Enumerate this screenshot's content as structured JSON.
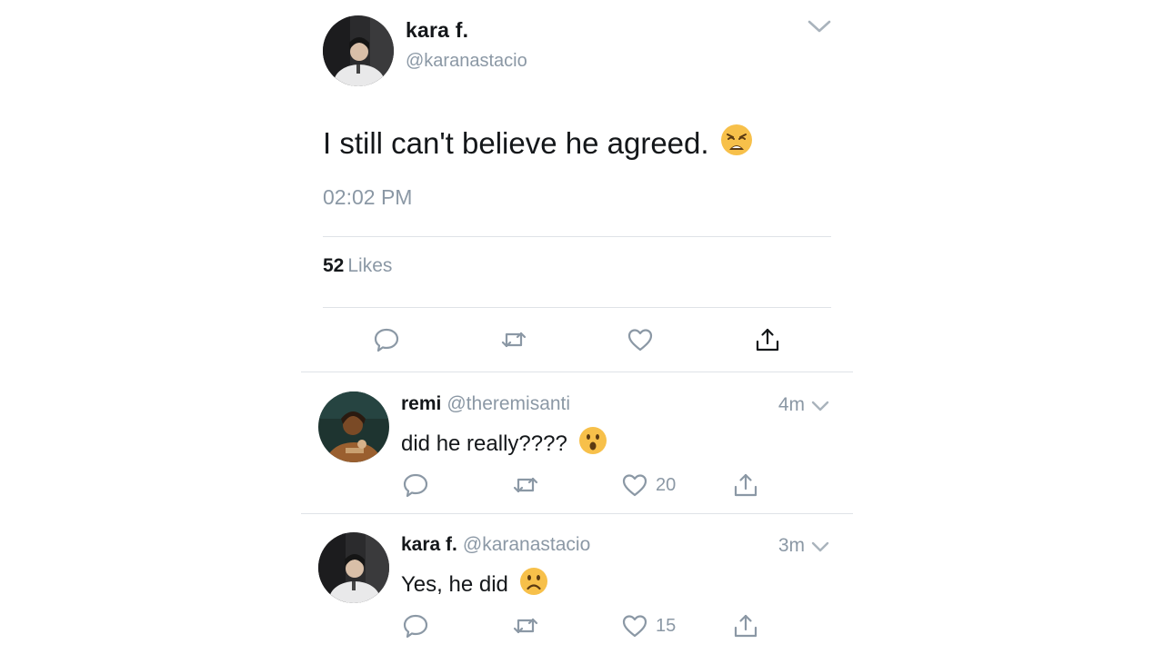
{
  "colors": {
    "text": "#14171a",
    "secondary": "#8b98a5",
    "divider": "#dfe3e7",
    "emoji_face": "#f7c04a"
  },
  "main_tweet": {
    "name": "kara f.",
    "handle": "@karanastacio",
    "text": "I still can't believe he agreed.",
    "emoji": "weary-face-emoji",
    "time": "02:02 PM",
    "likes_count": "52",
    "likes_label": "Likes",
    "actions": [
      "reply-icon",
      "retweet-icon",
      "like-icon",
      "share-icon"
    ]
  },
  "replies": [
    {
      "name": "remi",
      "handle": "@theremisanti",
      "time": "4m",
      "text": "did he really????",
      "emoji": "hushed-face-emoji",
      "like_count": "20"
    },
    {
      "name": "kara f.",
      "handle": "@karanastacio",
      "time": "3m",
      "text": "Yes, he did",
      "emoji": "frowning-face-emoji",
      "like_count": "15"
    }
  ]
}
